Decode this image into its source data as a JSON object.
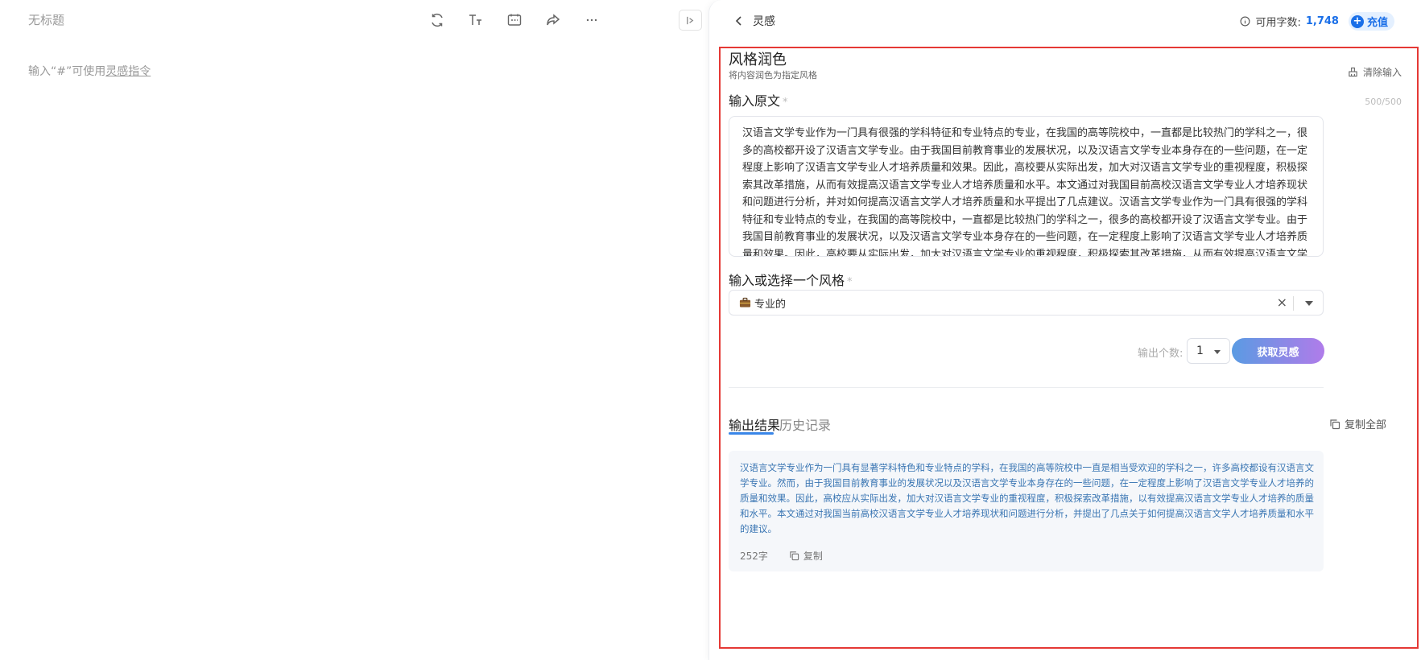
{
  "editor": {
    "title": "无标题",
    "hint_prefix": "输入“#”可使用",
    "hint_link": "灵感指令"
  },
  "panel": {
    "back_label": "灵感",
    "quota_label": "可用字数:",
    "quota_value": "1,748",
    "recharge_label": "充值"
  },
  "tool": {
    "title": "风格润色",
    "subtitle": "将内容润色为指定风格",
    "clear_label": "清除输入"
  },
  "source": {
    "label": "输入原文",
    "required_mark": "*",
    "counter": "500/500",
    "text": "汉语言文学专业作为一门具有很强的学科特征和专业特点的专业，在我国的高等院校中，一直都是比较热门的学科之一，很多的高校都开设了汉语言文学专业。由于我国目前教育事业的发展状况，以及汉语言文学专业本身存在的一些问题，在一定程度上影响了汉语言文学专业人才培养质量和效果。因此，高校要从实际出发，加大对汉语言文学专业的重视程度，积极探索其改革措施，从而有效提高汉语言文学专业人才培养质量和水平。本文通过对我国目前高校汉语言文学专业人才培养现状和问题进行分析，并对如何提高汉语言文学人才培养质量和水平提出了几点建议。汉语言文学专业作为一门具有很强的学科特征和专业特点的专业，在我国的高等院校中，一直都是比较热门的学科之一，很多的高校都开设了汉语言文学专业。由于我国目前教育事业的发展状况，以及汉语言文学专业本身存在的一些问题，在一定程度上影响了汉语言文学专业人才培养质量和效果。因此，高校要从实际出发，加大对汉语言文学专业的重视程度，积极探索其改革措施，从而有效提高汉语言文学专业人才培养质量和水平。本文通过对我国目前高校汉语言文学专业人才培养现状和问题进行分析，并对如何提高汉语言文学人才培养质量和水平提出了几"
  },
  "style": {
    "label": "输入或选择一个风格",
    "required_mark": "*",
    "selected": "专业的"
  },
  "output": {
    "count_label": "输出个数:",
    "count_value": "1",
    "generate_label": "获取灵感"
  },
  "results": {
    "tabs": [
      {
        "label": "输出结果",
        "active": true
      },
      {
        "label": "历史记录",
        "active": false
      }
    ],
    "copy_all_label": "复制全部",
    "items": [
      {
        "text": "汉语言文学专业作为一门具有显著学科特色和专业特点的学科，在我国的高等院校中一直是相当受欢迎的学科之一，许多高校都设有汉语言文学专业。然而，由于我国目前教育事业的发展状况以及汉语言文学专业本身存在的一些问题，在一定程度上影响了汉语言文学专业人才培养的质量和效果。因此，高校应从实际出发，加大对汉语言文学专业的重视程度，积极探索改革措施，以有效提高汉语言文学专业人才培养的质量和水平。本文通过对我国当前高校汉语言文学专业人才培养现状和问题进行分析，并提出了几点关于如何提高汉语言文学人才培养质量和水平的建议。",
        "char_count": "252字",
        "copy_label": "复制"
      }
    ]
  },
  "colors": {
    "accent": "#1a6fe8",
    "frame": "#e53935",
    "result_text": "#3a76b3"
  }
}
